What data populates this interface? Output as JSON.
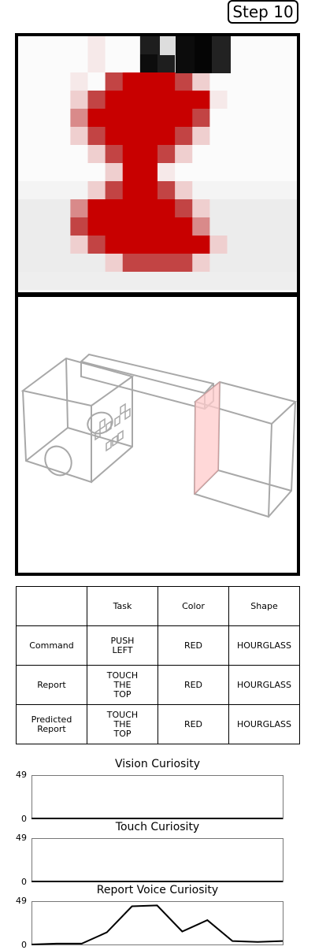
{
  "step_label": "Step 10",
  "vision_pixels": {
    "rows": 14,
    "cols": 16
  },
  "table": {
    "header": [
      "",
      "Task",
      "Color",
      "Shape"
    ],
    "rows": [
      [
        "Command",
        "PUSH\nLEFT",
        "RED",
        "HOURGLASS"
      ],
      [
        "Report",
        "TOUCH\nTHE\nTOP",
        "RED",
        "HOURGLASS"
      ],
      [
        "Predicted\nReport",
        "TOUCH\nTHE\nTOP",
        "RED",
        "HOURGLASS"
      ]
    ]
  },
  "colors": {
    "touch_highlight": "#ffcccc",
    "line": "#000000",
    "axis": "#777777"
  },
  "chart_data": [
    {
      "type": "line",
      "title": "Vision Curiosity",
      "ylim": [
        0,
        49
      ],
      "yticks": [
        "49",
        "0"
      ],
      "x": [
        0,
        1,
        2,
        3,
        4,
        5,
        6,
        7,
        8,
        9
      ],
      "series": [
        {
          "values": [
            0,
            0,
            0,
            0,
            0,
            0,
            0,
            0,
            0,
            0
          ]
        }
      ]
    },
    {
      "type": "line",
      "title": "Touch Curiosity",
      "ylim": [
        0,
        49
      ],
      "yticks": [
        "49",
        "0"
      ],
      "x": [
        0,
        1,
        2,
        3,
        4,
        5,
        6,
        7,
        8,
        9
      ],
      "series": [
        {
          "values": [
            0,
            0,
            0,
            0,
            0,
            0,
            0,
            0,
            0,
            0
          ]
        }
      ]
    },
    {
      "type": "line",
      "title": "Report Voice Curiosity",
      "ylim": [
        0,
        49
      ],
      "yticks": [
        "49",
        "0"
      ],
      "x": [
        0,
        1,
        2,
        3,
        4,
        5,
        6,
        7,
        8,
        9
      ],
      "series": [
        {
          "values": [
            0,
            1,
            1,
            14,
            44,
            45,
            15,
            28,
            4,
            3,
            4
          ]
        }
      ]
    }
  ]
}
